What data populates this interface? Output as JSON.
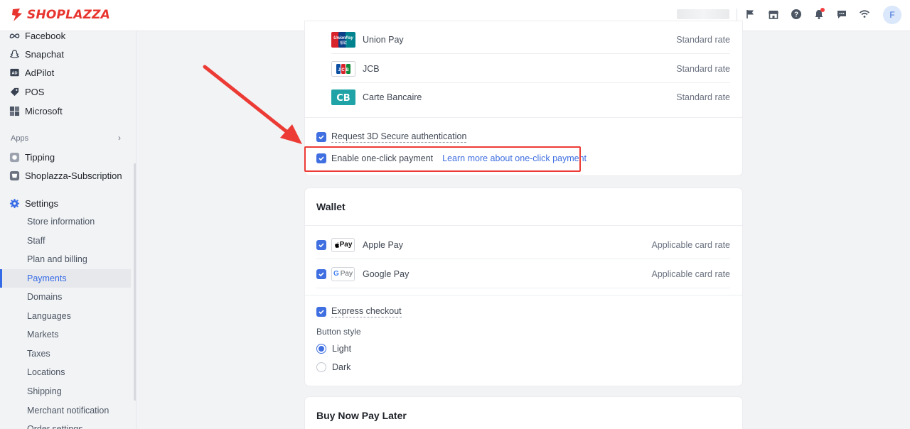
{
  "brand": {
    "name": "SHOPLAZZA",
    "color": "#e8342f"
  },
  "header": {
    "icons": [
      "flag-icon",
      "store-icon",
      "help-icon",
      "bell-icon",
      "chat-icon",
      "wifi-icon"
    ],
    "avatar_initial": "F"
  },
  "sidebar": {
    "channels": [
      {
        "label": "Facebook",
        "icon": "meta-icon"
      },
      {
        "label": "Snapchat",
        "icon": "snapchat-icon"
      },
      {
        "label": "AdPilot",
        "icon": "adpilot-icon"
      },
      {
        "label": "POS",
        "icon": "pos-icon"
      },
      {
        "label": "Microsoft",
        "icon": "microsoft-icon"
      }
    ],
    "apps_label": "Apps",
    "apps": [
      {
        "label": "Tipping",
        "icon": "tipping-icon"
      },
      {
        "label": "Shoplazza-Subscription",
        "icon": "subscription-icon"
      }
    ],
    "settings_label": "Settings",
    "settings_items": [
      "Store information",
      "Staff",
      "Plan and billing",
      "Payments",
      "Domains",
      "Languages",
      "Markets",
      "Taxes",
      "Locations",
      "Shipping",
      "Merchant notification",
      "Order settings"
    ],
    "active_item": "Payments"
  },
  "cards_section": {
    "payment_methods": [
      {
        "name": "Union Pay",
        "rate": "Standard rate",
        "logo": "unionpay-logo"
      },
      {
        "name": "JCB",
        "rate": "Standard rate",
        "logo": "jcb-logo"
      },
      {
        "name": "Carte Bancaire",
        "rate": "Standard rate",
        "logo": "cb-logo"
      }
    ],
    "request_3ds": {
      "label": "Request 3D Secure authentication",
      "checked": true
    },
    "one_click": {
      "label": "Enable one-click payment",
      "link": "Learn more about one-click payment",
      "checked": true
    }
  },
  "wallet": {
    "title": "Wallet",
    "items": [
      {
        "badge": "Pay",
        "name": "Apple Pay",
        "rate": "Applicable card rate",
        "checked": true
      },
      {
        "badge": "G Pay",
        "name": "Google Pay",
        "rate": "Applicable card rate",
        "checked": true
      }
    ],
    "express_checkout": {
      "label": "Express checkout",
      "checked": true
    },
    "button_style_label": "Button style",
    "button_styles": [
      {
        "label": "Light",
        "selected": true
      },
      {
        "label": "Dark",
        "selected": false
      }
    ]
  },
  "bnpl": {
    "title": "Buy Now Pay Later"
  },
  "colors": {
    "accent": "#3f6fe0",
    "annotation": "#ec3b35"
  }
}
